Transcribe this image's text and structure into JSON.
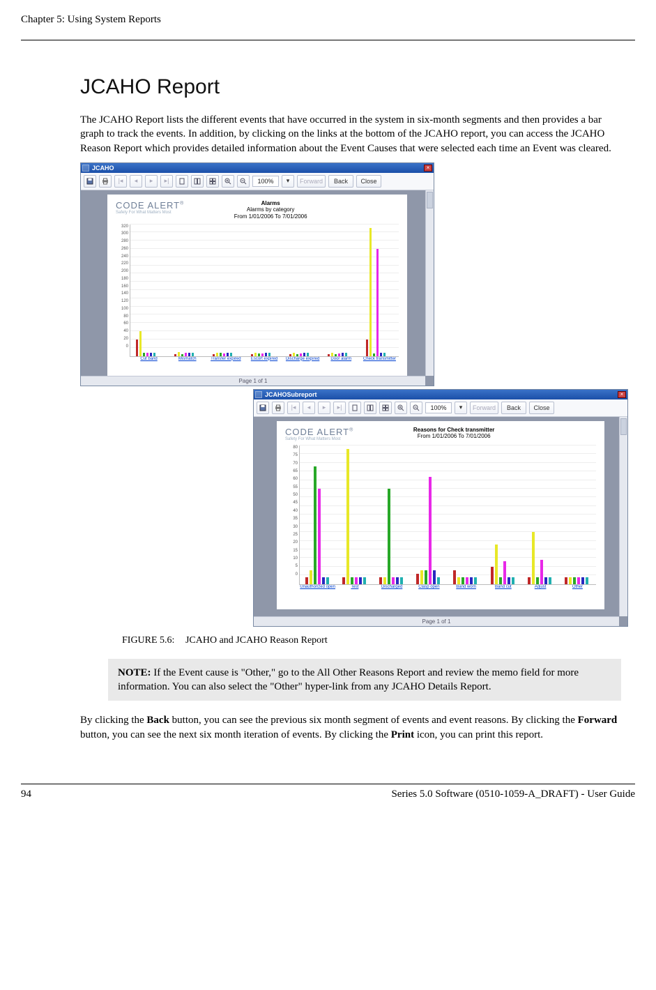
{
  "header_text": "Chapter 5: Using System Reports",
  "section_title": "JCAHO Report",
  "intro_paragraph": "The JCAHO Report lists the different events that have occurred in the system in six-month segments and then provides a bar graph to track the events. In addition, by clicking on the links at the bottom of the JCAHO report, you can access the JCAHO Reason Report which provides detailed information about the Event Causes that were selected each time an Event was cleared.",
  "figure_label": "FIGURE 5.6:",
  "figure_caption": "JCAHO and JCAHO Reason Report",
  "note_label": "NOTE:",
  "note_text": " If the Event cause is \"Other,\" go to the All Other Reasons Report and review the memo field for more information. You can also select the \"Other\" hyper-link from any JCAHO Details Report.",
  "closing_before_back": "By clicking the ",
  "closing_back": "Back",
  "closing_after_back": " button, you can see the previous six month segment of events and event reasons. By clicking the ",
  "closing_forward": "Forward",
  "closing_after_forward": " button, you can see the next six month iteration of events. By clicking the ",
  "closing_print": "Print",
  "closing_after_print": " icon, you can print this report.",
  "footer_page": "94",
  "footer_right": "Series 5.0 Software (0510-1059-A_DRAFT) - User Guide",
  "window1": {
    "title": "JCAHO",
    "zoom": "100%",
    "forward": "Forward",
    "back": "Back",
    "close": "Close",
    "page_status": "Page 1 of 1",
    "logo": "CODE ALERT",
    "logo_sub": "Safety For What Matters Most",
    "chart_title": "Alarms",
    "chart_subtitle": "Alarms by category",
    "chart_range": "From 1/01/2006 To 7/01/2006"
  },
  "window2": {
    "title": "JCAHOSubreport",
    "zoom": "100%",
    "forward": "Forward",
    "back": "Back",
    "close": "Close",
    "page_status": "Page 1 of 1",
    "logo": "CODE ALERT",
    "logo_sub": "Safety For What Matters Most",
    "chart_title": "Reasons for Check transmitter",
    "chart_range": "From 1/01/2006 To 7/01/2006"
  },
  "chart_data": [
    {
      "type": "bar",
      "title": "Alarms — Alarms by category — From 1/01/2006 To 7/01/2006",
      "ylabel": "",
      "ylim": [
        0,
        320
      ],
      "yticks": [
        320,
        300,
        280,
        260,
        240,
        220,
        200,
        180,
        160,
        140,
        120,
        100,
        80,
        60,
        40,
        20,
        0
      ],
      "categories": [
        "Cut band",
        "Mismatch",
        "Transfer expired",
        "Escort expired",
        "Discharge expired",
        "Door alarm",
        "Check transmitter"
      ],
      "series_colors": [
        "#c02828",
        "#e8e828",
        "#28a828",
        "#e828e8",
        "#2828c0",
        "#20b0b0"
      ],
      "data": [
        [
          40,
          60,
          8,
          8,
          8,
          8
        ],
        [
          4,
          10,
          4,
          8,
          8,
          8
        ],
        [
          4,
          8,
          8,
          6,
          8,
          8
        ],
        [
          4,
          8,
          6,
          6,
          8,
          8
        ],
        [
          4,
          8,
          4,
          6,
          8,
          8
        ],
        [
          4,
          8,
          4,
          6,
          8,
          8
        ],
        [
          40,
          310,
          6,
          260,
          8,
          8
        ]
      ]
    },
    {
      "type": "bar",
      "title": "Reasons for Check transmitter — From 1/01/2006 To 7/01/2006",
      "ylabel": "",
      "ylim": [
        0,
        80
      ],
      "yticks": [
        80,
        75,
        70,
        65,
        60,
        55,
        50,
        45,
        40,
        35,
        30,
        25,
        20,
        15,
        10,
        5,
        0
      ],
      "categories": [
        "Unauthorized open",
        "Test",
        "Discharged",
        "Clasp open",
        "Band worn",
        "Band cut",
        "Adjust",
        "Other"
      ],
      "series_colors": [
        "#c02828",
        "#e8e828",
        "#28a828",
        "#e828e8",
        "#2828c0",
        "#20b0b0"
      ],
      "data": [
        [
          4,
          8,
          68,
          55,
          4,
          4
        ],
        [
          4,
          78,
          4,
          4,
          4,
          4
        ],
        [
          4,
          4,
          55,
          4,
          4,
          4
        ],
        [
          6,
          8,
          8,
          62,
          8,
          4
        ],
        [
          8,
          4,
          4,
          4,
          4,
          4
        ],
        [
          10,
          23,
          4,
          13,
          4,
          4
        ],
        [
          4,
          30,
          4,
          14,
          4,
          4
        ],
        [
          4,
          4,
          4,
          4,
          4,
          4
        ]
      ]
    }
  ]
}
